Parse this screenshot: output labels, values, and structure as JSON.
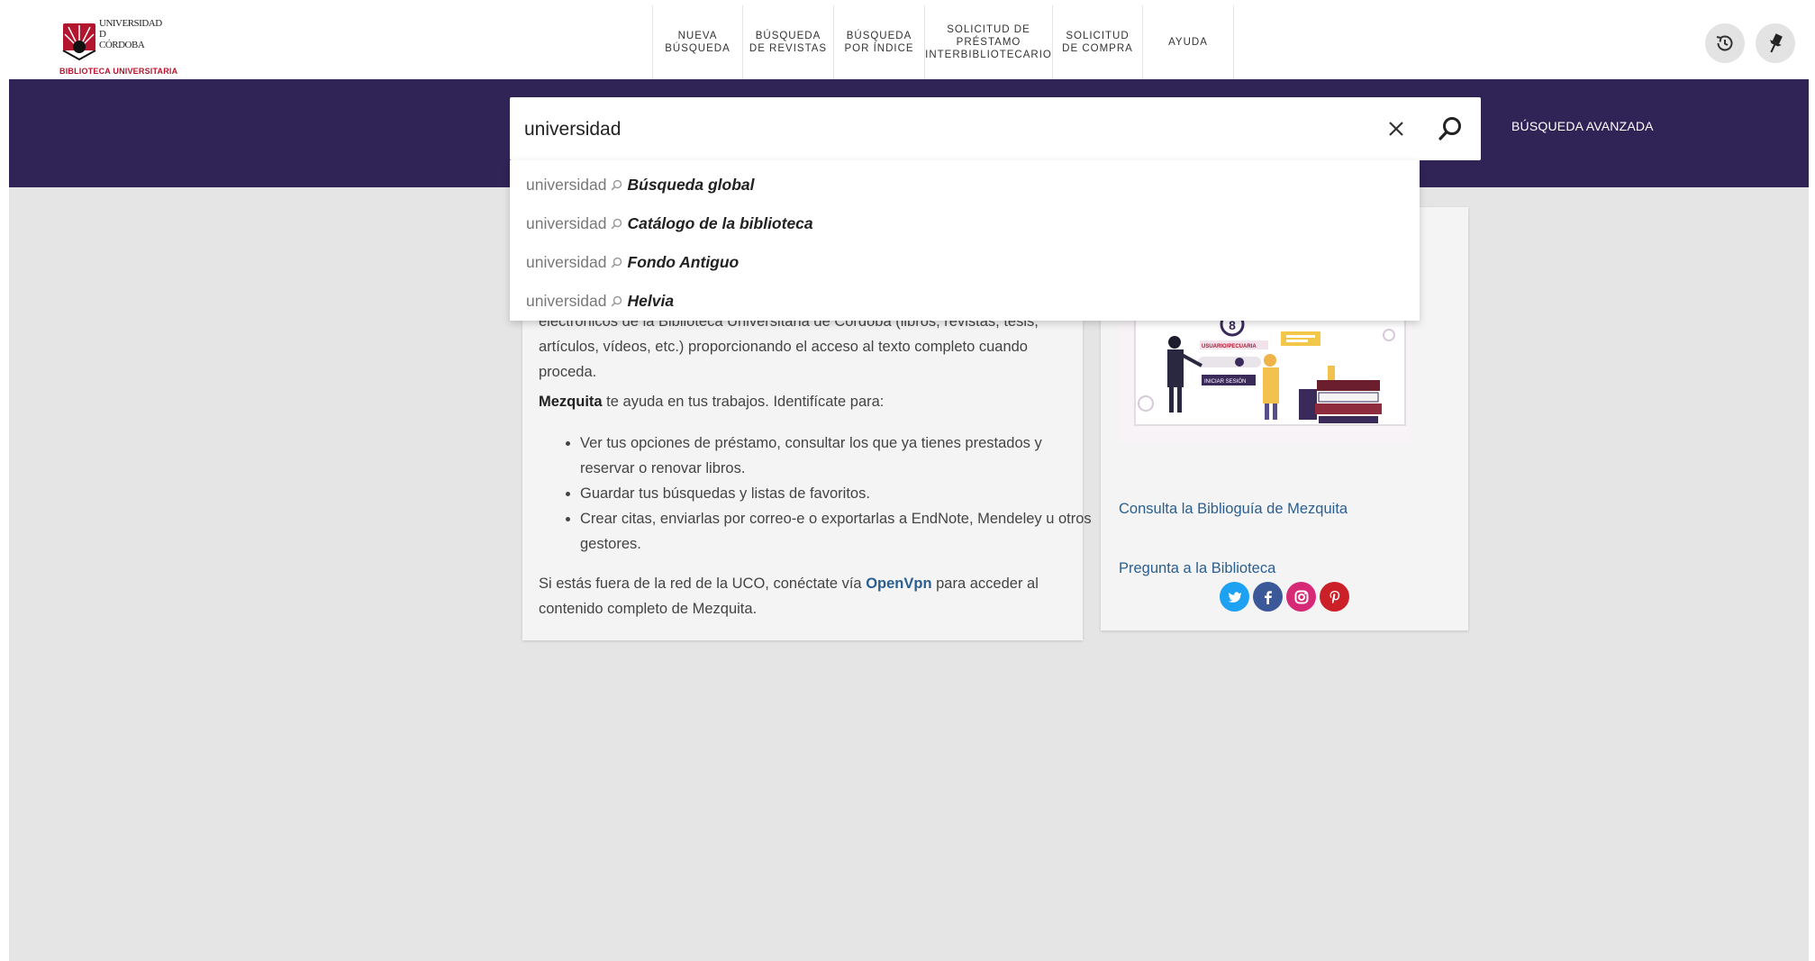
{
  "header": {
    "logo": {
      "name_lines": [
        "UNIVERSIDAD",
        "D",
        "CÓRDOBA"
      ],
      "subtitle": "BIBLIOTECA UNIVERSITARIA",
      "brand_color": "#b3152e"
    },
    "nav": [
      {
        "label": "NUEVA\nBÚSQUEDA"
      },
      {
        "label": "BÚSQUEDA\nDE REVISTAS"
      },
      {
        "label": "BÚSQUEDA\nPOR ÍNDICE"
      },
      {
        "label": "SOLICITUD DE\nPRÉSTAMO\nINTERBIBLIOTECARIO"
      },
      {
        "label": "SOLICITUD\nDE COMPRA"
      },
      {
        "label": "AYUDA"
      }
    ],
    "icons": [
      "history-icon",
      "pin-icon"
    ]
  },
  "search": {
    "value": "universidad",
    "advanced_label": "BÚSQUEDA AVANZADA",
    "bar_color": "#302356"
  },
  "suggestions": [
    {
      "query": "universidad",
      "scope": "Búsqueda global"
    },
    {
      "query": "universidad",
      "scope": "Catálogo de la biblioteca"
    },
    {
      "query": "universidad",
      "scope": "Fondo Antiguo"
    },
    {
      "query": "universidad",
      "scope": "Helvia"
    }
  ],
  "intro": {
    "cut_text": "electrónicos de la Biblioteca Universitaria de Córdoba (libros, revistas, tesis, artículos, vídeos, etc.) proporcionando el acceso al texto completo cuando proceda.",
    "p2_bold": "Mezquita",
    "p2_rest": " te ayuda en tus trabajos. Identifícate para:",
    "bullets": [
      "Ver tus opciones de préstamo, consultar los que ya tienes prestados y reservar o renovar libros.",
      "Guardar tus búsquedas y listas de favoritos.",
      "Crear citas, enviarlas por correo-e o exportarlas a EndNote, Mendeley u otros gestores."
    ],
    "p3_before": "Si estás fuera de la red de la UCO, conéctate vía ",
    "p3_link": "OpenVpn",
    "p3_after": " para acceder al contenido completo de Mezquita."
  },
  "side": {
    "illustration_labels": [
      "USUARIO/PECUARIA",
      "INICIAR SESIÓN"
    ],
    "guide_link": "Consulta la Biblioguía de Mezquita",
    "ask_link": "Pregunta a la Biblioteca",
    "social": [
      {
        "name": "twitter-icon",
        "color": "#1da1f2"
      },
      {
        "name": "facebook-icon",
        "color": "#3b5998"
      },
      {
        "name": "instagram-icon",
        "color": "#d62976"
      },
      {
        "name": "pinterest-icon",
        "color": "#cb2027"
      }
    ]
  }
}
